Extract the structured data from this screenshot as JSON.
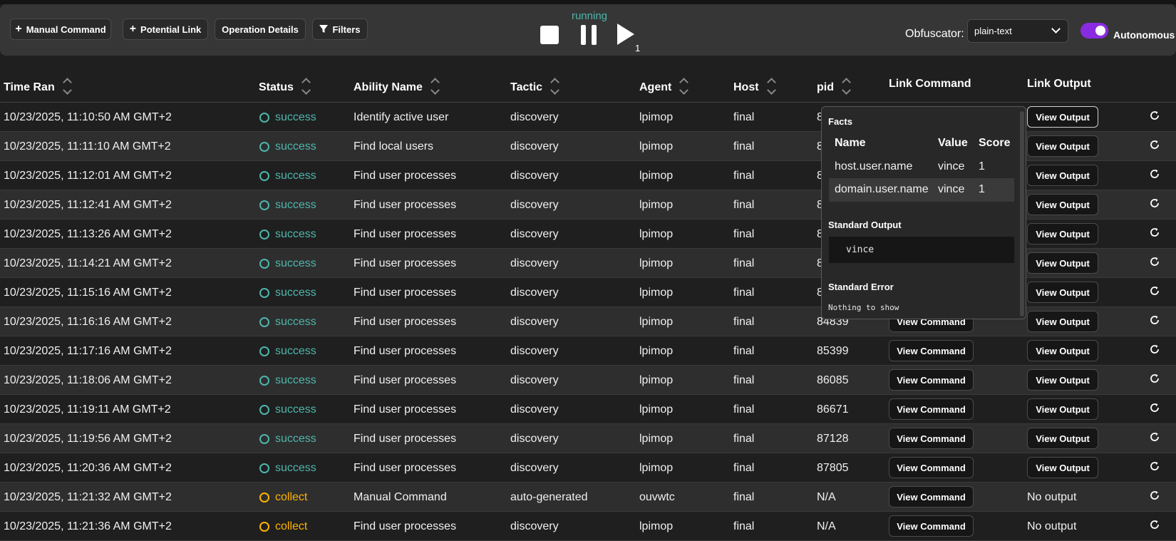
{
  "toolbar": {
    "manual_command": "Manual Command",
    "potential_link": "Potential Link",
    "operation_details": "Operation Details",
    "filters": "Filters",
    "state": "running",
    "play_count": "1",
    "obfuscator_label": "Obfuscator:",
    "obfuscator_value": "plain-text",
    "autonomous_label": "Autonomous",
    "autonomous_on": true,
    "accent_color": "#8a2be2",
    "status_color": "#4db6ac"
  },
  "table": {
    "headers": {
      "time_ran": "Time Ran",
      "status": "Status",
      "ability_name": "Ability Name",
      "tactic": "Tactic",
      "agent": "Agent",
      "host": "Host",
      "pid": "pid",
      "link_command": "Link Command",
      "link_output": "Link Output"
    },
    "rows": [
      {
        "time": "10/23/2025, 11:10:50 AM GMT+2",
        "status": "success",
        "ability": "Identify active user",
        "tactic": "discovery",
        "agent": "lpimop",
        "host": "final",
        "pid": "8",
        "cmd": "",
        "out": "View Output"
      },
      {
        "time": "10/23/2025, 11:11:10 AM GMT+2",
        "status": "success",
        "ability": "Find local users",
        "tactic": "discovery",
        "agent": "lpimop",
        "host": "final",
        "pid": "8",
        "cmd": "",
        "out": "View Output"
      },
      {
        "time": "10/23/2025, 11:12:01 AM GMT+2",
        "status": "success",
        "ability": "Find user processes",
        "tactic": "discovery",
        "agent": "lpimop",
        "host": "final",
        "pid": "8",
        "cmd": "",
        "out": "View Output"
      },
      {
        "time": "10/23/2025, 11:12:41 AM GMT+2",
        "status": "success",
        "ability": "Find user processes",
        "tactic": "discovery",
        "agent": "lpimop",
        "host": "final",
        "pid": "8",
        "cmd": "",
        "out": "View Output"
      },
      {
        "time": "10/23/2025, 11:13:26 AM GMT+2",
        "status": "success",
        "ability": "Find user processes",
        "tactic": "discovery",
        "agent": "lpimop",
        "host": "final",
        "pid": "8",
        "cmd": "",
        "out": "View Output"
      },
      {
        "time": "10/23/2025, 11:14:21 AM GMT+2",
        "status": "success",
        "ability": "Find user processes",
        "tactic": "discovery",
        "agent": "lpimop",
        "host": "final",
        "pid": "8",
        "cmd": "",
        "out": "View Output"
      },
      {
        "time": "10/23/2025, 11:15:16 AM GMT+2",
        "status": "success",
        "ability": "Find user processes",
        "tactic": "discovery",
        "agent": "lpimop",
        "host": "final",
        "pid": "8",
        "cmd": "",
        "out": "View Output"
      },
      {
        "time": "10/23/2025, 11:16:16 AM GMT+2",
        "status": "success",
        "ability": "Find user processes",
        "tactic": "discovery",
        "agent": "lpimop",
        "host": "final",
        "pid": "84839",
        "cmd": "View Command",
        "out": "View Output"
      },
      {
        "time": "10/23/2025, 11:17:16 AM GMT+2",
        "status": "success",
        "ability": "Find user processes",
        "tactic": "discovery",
        "agent": "lpimop",
        "host": "final",
        "pid": "85399",
        "cmd": "View Command",
        "out": "View Output"
      },
      {
        "time": "10/23/2025, 11:18:06 AM GMT+2",
        "status": "success",
        "ability": "Find user processes",
        "tactic": "discovery",
        "agent": "lpimop",
        "host": "final",
        "pid": "86085",
        "cmd": "View Command",
        "out": "View Output"
      },
      {
        "time": "10/23/2025, 11:19:11 AM GMT+2",
        "status": "success",
        "ability": "Find user processes",
        "tactic": "discovery",
        "agent": "lpimop",
        "host": "final",
        "pid": "86671",
        "cmd": "View Command",
        "out": "View Output"
      },
      {
        "time": "10/23/2025, 11:19:56 AM GMT+2",
        "status": "success",
        "ability": "Find user processes",
        "tactic": "discovery",
        "agent": "lpimop",
        "host": "final",
        "pid": "87128",
        "cmd": "View Command",
        "out": "View Output"
      },
      {
        "time": "10/23/2025, 11:20:36 AM GMT+2",
        "status": "success",
        "ability": "Find user processes",
        "tactic": "discovery",
        "agent": "lpimop",
        "host": "final",
        "pid": "87805",
        "cmd": "View Command",
        "out": "View Output"
      },
      {
        "time": "10/23/2025, 11:21:32 AM GMT+2",
        "status": "collect",
        "ability": "Manual Command",
        "tactic": "auto-generated",
        "agent": "ouvwtc",
        "host": "final",
        "pid": "N/A",
        "cmd": "View Command",
        "out": "No output"
      },
      {
        "time": "10/23/2025, 11:21:36 AM GMT+2",
        "status": "collect",
        "ability": "Find user processes",
        "tactic": "discovery",
        "agent": "lpimop",
        "host": "final",
        "pid": "N/A",
        "cmd": "View Command",
        "out": "No output"
      }
    ]
  },
  "popup": {
    "facts_title": "Facts",
    "headers": {
      "name": "Name",
      "value": "Value",
      "score": "Score"
    },
    "facts": [
      {
        "name": "host.user.name",
        "value": "vince",
        "score": "1"
      },
      {
        "name": "domain.user.name",
        "value": "vince",
        "score": "1"
      }
    ],
    "stdout_title": "Standard Output",
    "stdout": "vince",
    "stderr_title": "Standard Error",
    "stderr": "Nothing to show"
  }
}
